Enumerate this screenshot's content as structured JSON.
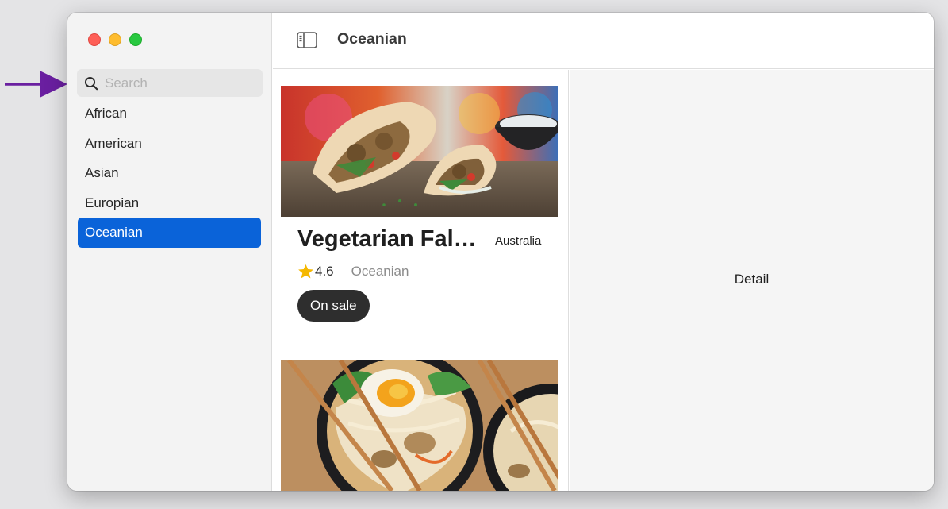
{
  "window": {
    "toolbar_title": "Oceanian"
  },
  "sidebar": {
    "search": {
      "placeholder": "Search",
      "value": ""
    },
    "categories": [
      {
        "label": "African",
        "selected": false
      },
      {
        "label": "American",
        "selected": false
      },
      {
        "label": "Asian",
        "selected": false
      },
      {
        "label": "Europian",
        "selected": false
      },
      {
        "label": "Oceanian",
        "selected": true
      }
    ]
  },
  "list": {
    "items": [
      {
        "name": "Vegetarian Fala...",
        "country": "Australia",
        "rating": "4.6",
        "cuisine": "Oceanian",
        "badge": "On sale",
        "image": "falafel-pita-photo"
      },
      {
        "image": "ramen-bowl-photo"
      }
    ]
  },
  "detail": {
    "placeholder": "Detail"
  },
  "colors": {
    "accent": "#0a63d9",
    "annotation_arrow": "#6a1fa0",
    "star": "#f5b800",
    "badge": "#2e2e2e"
  },
  "icons": [
    "search-icon",
    "sidebar-toggle-icon",
    "star-icon"
  ]
}
